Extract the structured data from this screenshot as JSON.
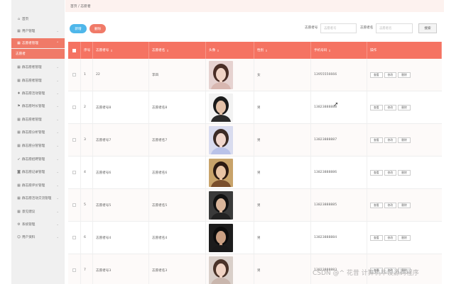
{
  "sidebar": {
    "items": [
      {
        "label": "首页",
        "icon": "home-icon",
        "glyph": "⌂",
        "has_chevron": false,
        "state": "normal"
      },
      {
        "label": "用户管理",
        "icon": "grid-icon",
        "glyph": "▦",
        "has_chevron": true,
        "state": "normal"
      },
      {
        "label": "志愿者管理",
        "icon": "grid-icon",
        "glyph": "▦",
        "has_chevron": true,
        "state": "active"
      },
      {
        "label": "志愿者",
        "icon": "",
        "glyph": "",
        "has_chevron": false,
        "state": "sub"
      },
      {
        "label": "群志愿者管理",
        "icon": "grid-icon",
        "glyph": "▦",
        "has_chevron": true,
        "state": "normal"
      },
      {
        "label": "群志愿者管理",
        "icon": "grid-icon",
        "glyph": "▦",
        "has_chevron": true,
        "state": "normal"
      },
      {
        "label": "群志愿活动管理",
        "icon": "bulb-icon",
        "glyph": "♦",
        "has_chevron": true,
        "state": "normal"
      },
      {
        "label": "群志愿时长管理",
        "icon": "flag-icon",
        "glyph": "⚑",
        "has_chevron": true,
        "state": "normal"
      },
      {
        "label": "群志愿者管理",
        "icon": "grid-icon",
        "glyph": "▦",
        "has_chevron": true,
        "state": "normal"
      },
      {
        "label": "群志愿分析管理",
        "icon": "grid-icon",
        "glyph": "▦",
        "has_chevron": true,
        "state": "normal"
      },
      {
        "label": "群志愿分管管理",
        "icon": "grid-icon",
        "glyph": "▦",
        "has_chevron": true,
        "state": "normal"
      },
      {
        "label": "群志愿招聘管理",
        "icon": "rocket-icon",
        "glyph": "➶",
        "has_chevron": true,
        "state": "normal"
      },
      {
        "label": "群志愿记录管理",
        "icon": "camera-icon",
        "glyph": "◙",
        "has_chevron": true,
        "state": "normal"
      },
      {
        "label": "群志愿评价管理",
        "icon": "grid-icon",
        "glyph": "▦",
        "has_chevron": true,
        "state": "normal"
      },
      {
        "label": "群志愿活动交流管理",
        "icon": "grid-icon",
        "glyph": "▦",
        "has_chevron": true,
        "state": "normal"
      },
      {
        "label": "意见建议",
        "icon": "grid-icon",
        "glyph": "▦",
        "has_chevron": true,
        "state": "normal"
      },
      {
        "label": "系统管理",
        "icon": "gear-icon",
        "glyph": "⚙",
        "has_chevron": true,
        "state": "normal"
      },
      {
        "label": "用户资料",
        "icon": "user-icon",
        "glyph": "☺",
        "has_chevron": true,
        "state": "normal"
      }
    ]
  },
  "breadcrumb": "首页 / 志愿者",
  "toolbar": {
    "add_label": "新增",
    "delete_label": "删除",
    "search_no_label": "志愿者号",
    "search_no_placeholder": "志愿者号",
    "search_name_label": "志愿者名",
    "search_name_placeholder": "志愿者名",
    "search_button": "搜索"
  },
  "table": {
    "columns": [
      "序号",
      "志愿者号",
      "志愿者名",
      "头像",
      "性别",
      "手机号码",
      "操作"
    ],
    "op_labels": [
      "查看",
      "修改",
      "删除"
    ],
    "rows": [
      {
        "idx": "1",
        "no": "22",
        "name": "李四",
        "sex": "女",
        "phone": "13955556666",
        "photo": {
          "bg": "#e6d2d0",
          "hair": "#4a2e26",
          "skin": "#f1d4c6",
          "shirt": "#d8b7b0"
        }
      },
      {
        "idx": "2",
        "no": "志愿者号8",
        "name": "志愿者名8",
        "sex": "男",
        "phone": "13823888888",
        "photo": {
          "bg": "#f2f2f2",
          "hair": "#1a1a1a",
          "skin": "#e3c1a8",
          "shirt": "#2a2a2a"
        }
      },
      {
        "idx": "3",
        "no": "志愿者号7",
        "name": "志愿者名7",
        "sex": "男",
        "phone": "13823888887",
        "photo": {
          "bg": "#d9dcef",
          "hair": "#3b2b26",
          "skin": "#f0d6cc",
          "shirt": "#b9c2e8"
        }
      },
      {
        "idx": "4",
        "no": "志愿者号6",
        "name": "志愿者名6",
        "sex": "男",
        "phone": "13823888886",
        "photo": {
          "bg": "#c8a36a",
          "hair": "#2b1a12",
          "skin": "#e8c4a4",
          "shirt": "#7a4e2b"
        }
      },
      {
        "idx": "5",
        "no": "志愿者号5",
        "name": "志愿者名5",
        "sex": "男",
        "phone": "13823888885",
        "photo": {
          "bg": "#3a3a3a",
          "hair": "#111111",
          "skin": "#d9b59a",
          "shirt": "#222222"
        }
      },
      {
        "idx": "6",
        "no": "志愿者号4",
        "name": "志愿者名4",
        "sex": "男",
        "phone": "13823888884",
        "photo": {
          "bg": "#1c1c1c",
          "hair": "#0d0d0d",
          "skin": "#caa083",
          "shirt": "#1a1a1a"
        }
      },
      {
        "idx": "7",
        "no": "志愿者号3",
        "name": "志愿者名3",
        "sex": "男",
        "phone": "13823888883",
        "photo": {
          "bg": "#d9cfc9",
          "hair": "#4a3328",
          "skin": "#f0d3c3",
          "shirt": "#c9b6ad"
        }
      }
    ]
  },
  "watermark": "CSDN @^ 花昔 计算机毕设源码程序",
  "colors": {
    "accent": "#f57362",
    "primary_button": "#4fb7ea",
    "sidebar_bg": "#f0f0f0"
  }
}
